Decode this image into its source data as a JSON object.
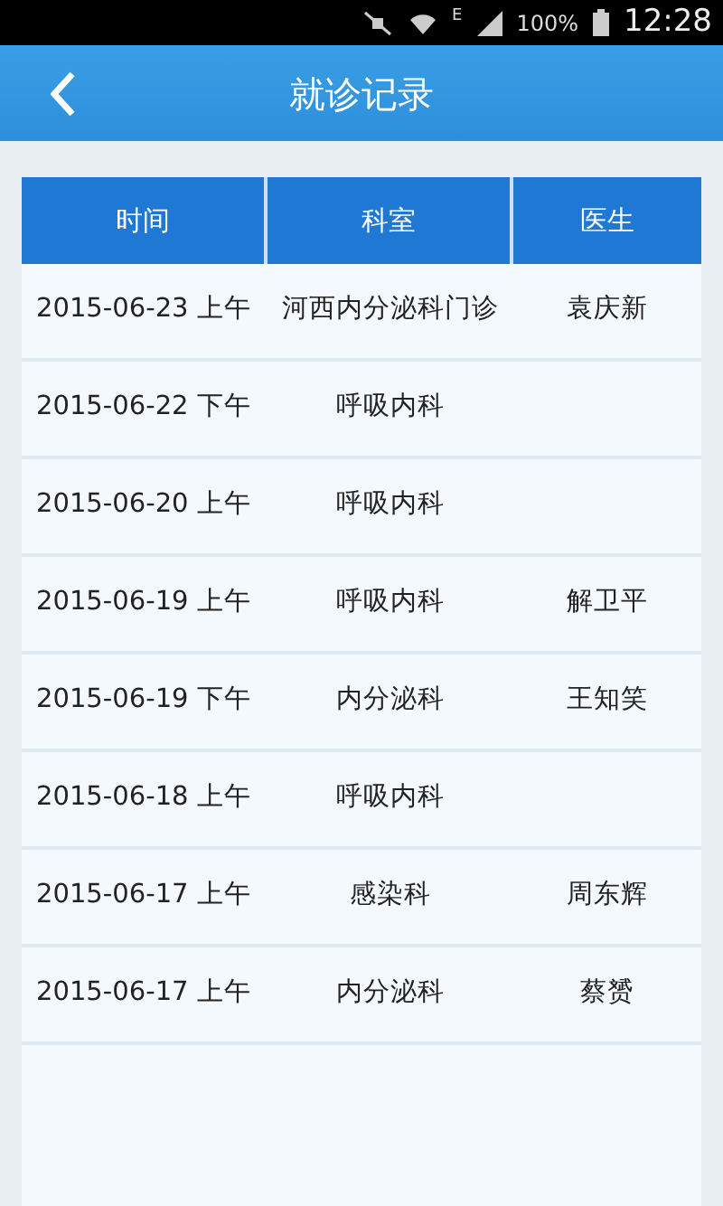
{
  "status_bar": {
    "network": "E",
    "battery": "100%",
    "time": "12:28"
  },
  "header": {
    "title": "就诊记录"
  },
  "table": {
    "columns": [
      "时间",
      "科室",
      "医生"
    ],
    "rows": [
      [
        "2015-06-23 上午",
        "河西内分泌科门诊",
        "袁庆新"
      ],
      [
        "2015-06-22 下午",
        "呼吸内科",
        ""
      ],
      [
        "2015-06-20 上午",
        "呼吸内科",
        ""
      ],
      [
        "2015-06-19 上午",
        "呼吸内科",
        "解卫平"
      ],
      [
        "2015-06-19 下午",
        "内分泌科",
        "王知笑"
      ],
      [
        "2015-06-18 上午",
        "呼吸内科",
        ""
      ],
      [
        "2015-06-17 上午",
        "感染科",
        "周东辉"
      ],
      [
        "2015-06-17 上午",
        "内分泌科",
        "蔡赟"
      ]
    ]
  }
}
